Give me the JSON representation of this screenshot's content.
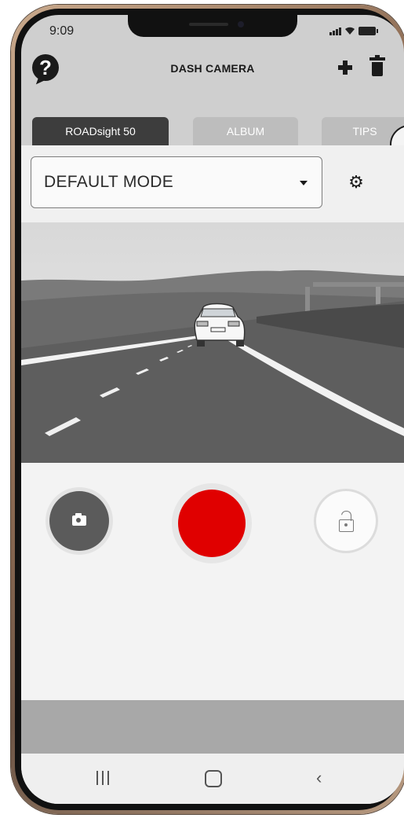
{
  "status": {
    "time": "9:09"
  },
  "app": {
    "title": "DASH CAMERA"
  },
  "tabs": [
    {
      "label": "ROADsight 50",
      "active": true
    },
    {
      "label": "ALBUM",
      "active": false
    },
    {
      "label": "TIPS",
      "active": false
    }
  ],
  "mode": {
    "selected": "DEFAULT MODE"
  },
  "icons": {
    "help": "help-icon",
    "add": "plus-icon",
    "delete": "trash-icon",
    "settings": "gear-icon",
    "snapshot": "camera-icon",
    "lock": "unlock-icon"
  },
  "colors": {
    "record": "#e00000",
    "active_tab": "#3d3d3d",
    "inactive_tab": "#bdbdbd"
  }
}
